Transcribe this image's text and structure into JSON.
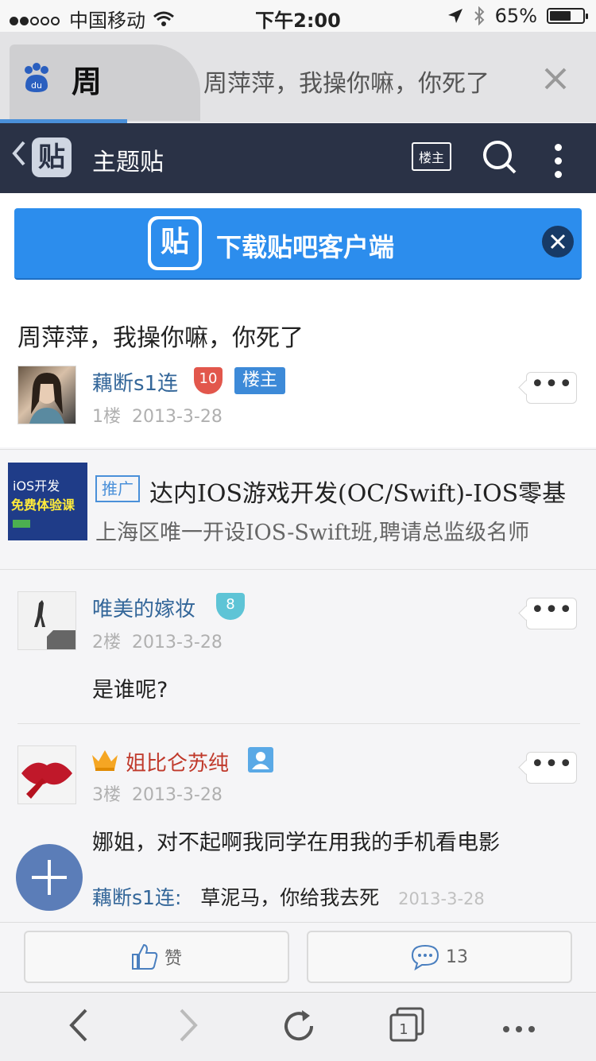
{
  "status_bar": {
    "carrier": "中国移动",
    "time": "下午2:00",
    "battery": "65%",
    "battery_level": 0.65
  },
  "browser_tab": {
    "tab_label": "周",
    "page_title": "周萍萍，我操你嘛，你死了"
  },
  "app_header": {
    "title": "主题贴",
    "tie_icon": "贴",
    "owner_button": "楼主"
  },
  "banner": {
    "icon": "贴",
    "text": "下载贴吧客户端"
  },
  "post": {
    "title": "周萍萍，我操你嘛，你死了",
    "author": "藕断s1连",
    "level": "10",
    "owner_tag": "楼主",
    "floor": "1楼",
    "date": "2013-3-28"
  },
  "ad": {
    "img_line1": "iOS开发",
    "img_line2": "免费体验课",
    "tag": "推广",
    "title": "达内IOS游戏开发(OC/Swift)-IOS零基",
    "subtitle": "上海区唯一开设IOS-Swift班,聘请总监级名师"
  },
  "replies": [
    {
      "author": "唯美的嫁妆",
      "level": "8",
      "floor": "2楼",
      "date": "2013-3-28",
      "content": "是谁呢?"
    },
    {
      "author": "姐比仑苏纯",
      "floor": "3楼",
      "date": "2013-3-28",
      "content": "娜姐，对不起啊我同学在用我的手机看电影"
    }
  ],
  "sub_reply": {
    "author": "藕断s1连",
    "separator": ":",
    "content": "草泥马，你给我去死",
    "date": "2013-3-28"
  },
  "actions": {
    "like": "赞",
    "comments": "13"
  },
  "options_label": "•••",
  "colors": {
    "header_bg": "#2a3246",
    "banner_bg": "#2c8ded",
    "username": "#336699",
    "vip_name": "#c0392b",
    "fab": "#5b7db8"
  }
}
